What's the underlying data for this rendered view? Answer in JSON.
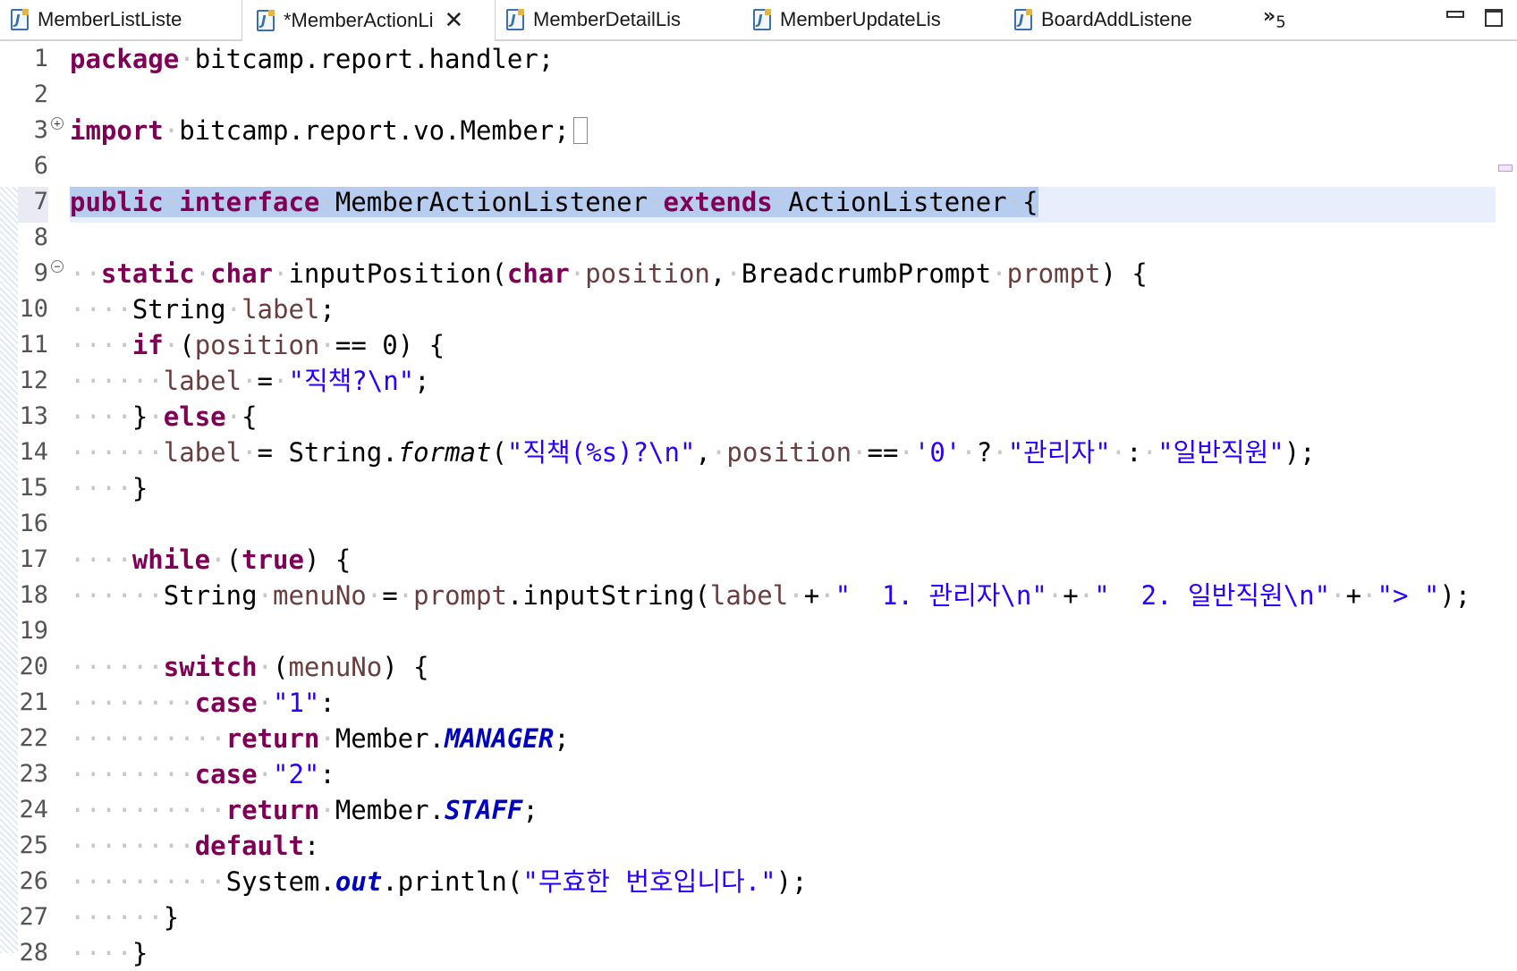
{
  "tabs": [
    {
      "label": "MemberListListe",
      "active": false
    },
    {
      "label": "*MemberActionLi",
      "active": true
    },
    {
      "label": "MemberDetailLis",
      "active": false
    },
    {
      "label": "MemberUpdateLis",
      "active": false
    },
    {
      "label": "BoardAddListene",
      "active": false
    }
  ],
  "tab_overflow": {
    "symbol": "»",
    "count": "5"
  },
  "file_icon_glyph": "J",
  "editor": {
    "line_numbers": [
      "1",
      "2",
      "3",
      "6",
      "7",
      "8",
      "9",
      "10",
      "11",
      "12",
      "13",
      "14",
      "15",
      "16",
      "17",
      "18",
      "19",
      "20",
      "21",
      "22",
      "23",
      "24",
      "25",
      "26",
      "27",
      "28"
    ],
    "current_line": "7",
    "colors": {
      "keyword": "#7f0055",
      "string": "#2a00ff",
      "local_variable": "#6a3e3e",
      "static_field": "#0000c0",
      "selection": "#b7cdef",
      "current_line": "#e8eefb"
    },
    "lines": {
      "l1_kw": "package",
      "l1_rest": "bitcamp.report.handler;",
      "l3_kw": "import",
      "l3_rest": "bitcamp.report.vo.Member;",
      "l7_public": "public",
      "l7_interface": "interface",
      "l7_name": "MemberActionListener",
      "l7_extends": "extends",
      "l7_parent": "ActionListener",
      "l7_brace": "{",
      "l9_static": "static",
      "l9_char": "char",
      "l9_method": "inputPosition(",
      "l9_char2": "char",
      "l9_position": "position",
      "l9_comma": ",",
      "l9_type": "BreadcrumbPrompt",
      "l9_prompt": "prompt",
      "l9_end": ") {",
      "l10_type": "String",
      "l10_var": "label",
      "l10_end": ";",
      "l11_if": "if",
      "l11_open": "(",
      "l11_var": "position",
      "l11_cond": "== 0) {",
      "l12_var": "label",
      "l12_eq": "=",
      "l12_str": "\"직책?\\n\"",
      "l12_end": ";",
      "l13_close": "}",
      "l13_else": "else",
      "l13_open": "{",
      "l14_var": "label",
      "l14_eq": "= String.",
      "l14_format": "format",
      "l14_open": "(",
      "l14_str1": "\"직책(%s)?\\n\"",
      "l14_comma": ",",
      "l14_var2": "position",
      "l14_op": "==",
      "l14_char": "'0'",
      "l14_q": "?",
      "l14_str2": "\"관리자\"",
      "l14_colon": ":",
      "l14_str3": "\"일반직원\"",
      "l14_end": ");",
      "l15_close": "}",
      "l17_while": "while",
      "l17_open": "(",
      "l17_true": "true",
      "l17_end": ") {",
      "l18_type": "String",
      "l18_var": "menuNo",
      "l18_eq": "=",
      "l18_prompt": "prompt",
      "l18_call": ".inputString(",
      "l18_label": "label",
      "l18_plus1": "+",
      "l18_str1": "\"  1. 관리자\\n\"",
      "l18_plus2": "+",
      "l18_str2": "\"  2. 일반직원\\n\"",
      "l18_plus3": "+",
      "l18_str3": "\"> \"",
      "l18_end": ");",
      "l20_switch": "switch",
      "l20_open": "(",
      "l20_var": "menuNo",
      "l20_end": ") {",
      "l21_case": "case",
      "l21_str": "\"1\"",
      "l21_colon": ":",
      "l22_return": "return",
      "l22_cls": "Member.",
      "l22_field": "MANAGER",
      "l22_end": ";",
      "l23_case": "case",
      "l23_str": "\"2\"",
      "l23_colon": ":",
      "l24_return": "return",
      "l24_cls": "Member.",
      "l24_field": "STAFF",
      "l24_end": ";",
      "l25_default": "default",
      "l25_colon": ":",
      "l26_sys": "System.",
      "l26_out": "out",
      "l26_call": ".println(",
      "l26_str": "\"무효한 번호입니다.\"",
      "l26_end": ");",
      "l27_close": "}",
      "l28_close": "}"
    }
  }
}
